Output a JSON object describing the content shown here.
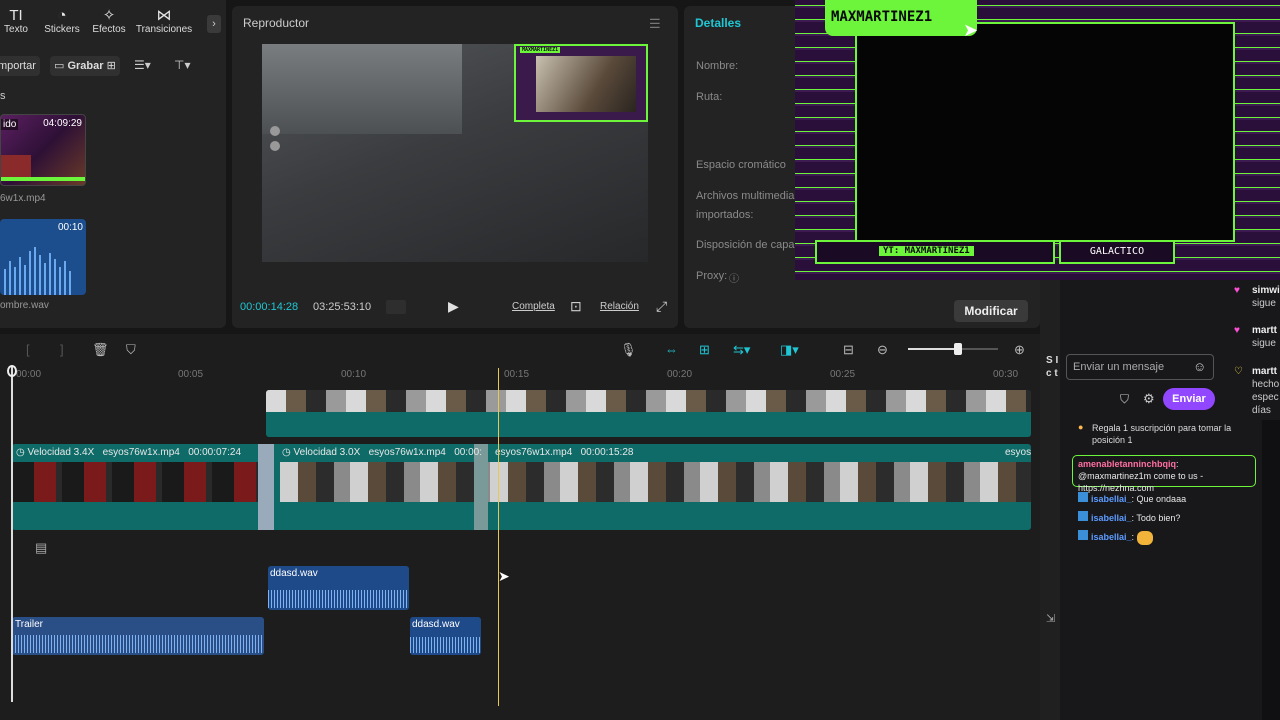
{
  "media_panel": {
    "tools": [
      "Texto",
      "Stickers",
      "Efectos",
      "Transiciones"
    ],
    "importar": "mportar",
    "grabar": "Grabar",
    "section_letter": "s",
    "items": [
      {
        "badge_left": "ido",
        "duration": "04:09:29",
        "name": "6w1x.mp4"
      },
      {
        "duration": "00:10",
        "name": "ombre.wav"
      }
    ]
  },
  "player": {
    "title": "Reproductor",
    "current_time": "00:00:14:28",
    "total_time": "03:25:53:10",
    "btn_full": "Completa",
    "btn_ratio": "Relación",
    "pip_name": "MAXMARTINEZ1"
  },
  "details": {
    "title": "Detalles",
    "fields": [
      "Nombre:",
      "Ruta:",
      "Espacio cromático",
      "Archivos multimedia",
      "importados:",
      "Disposición de capa",
      "Proxy:"
    ],
    "modify": "Modificar"
  },
  "timeline": {
    "ticks": [
      "00:00",
      "00:05",
      "00:10",
      "00:15",
      "00:20",
      "00:25",
      "00:30"
    ],
    "clip1": {
      "speed": "Velocidad 3.4X",
      "name": "esyos76w1x.mp4",
      "time": "00:00:07:24"
    },
    "clip2": {
      "speed": "Velocidad 3.0X",
      "name": "esyos76w1x.mp4",
      "time": "00:00:"
    },
    "clip3": {
      "name": "esyos76w1x.mp4",
      "time": "00:00:15:28"
    },
    "clip4": {
      "name": "esyos"
    },
    "audio1": "ddasd.wav",
    "audio2": "Trailer",
    "audio3": "ddasd.wav"
  },
  "stream": {
    "streamer": "MAXMARTINEZ1",
    "yt": "YT: MAXMARTINEZ1",
    "galactico": "GALACTICO"
  },
  "chat": {
    "right_snips": [
      {
        "u": "simwi",
        "t": "sigue"
      },
      {
        "u": "martt",
        "t": "sigue"
      },
      {
        "u": "martt",
        "t": "hecho"
      },
      {
        "extra": "espec"
      },
      {
        "extra": "días"
      }
    ],
    "placeholder": "Enviar un mensaje",
    "send": "Enviar",
    "gift": "Regala 1 suscripción para tomar la posición 1",
    "messages": [
      {
        "user": "amenabletanninchbqiq",
        "text": ": @maxmartinez1m come to us - https://nezhna.com"
      },
      {
        "user": "isabellai_",
        "text": ": Que ondaaa"
      },
      {
        "user": "isabellai_",
        "text": ": Todo bien?"
      },
      {
        "user": "isabellai_",
        "text": ":"
      }
    ]
  },
  "colors": {
    "accent": "#00c1cd",
    "twitch": "#9147ff",
    "neon": "#6cf53b",
    "playhead": "#e8c850"
  }
}
